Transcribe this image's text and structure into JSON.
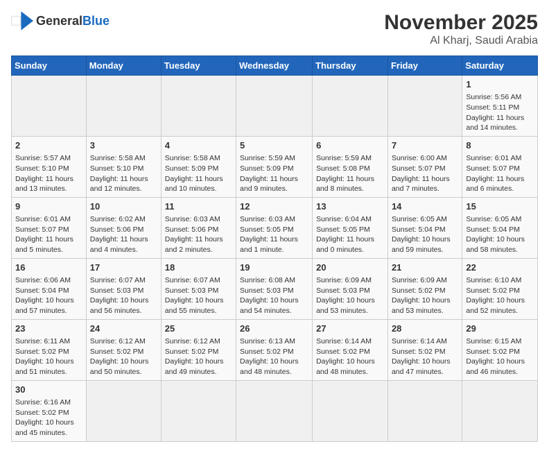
{
  "header": {
    "logo_general": "General",
    "logo_blue": "Blue",
    "month": "November 2025",
    "location": "Al Kharj, Saudi Arabia"
  },
  "weekdays": [
    "Sunday",
    "Monday",
    "Tuesday",
    "Wednesday",
    "Thursday",
    "Friday",
    "Saturday"
  ],
  "weeks": [
    [
      {
        "day": "",
        "info": ""
      },
      {
        "day": "",
        "info": ""
      },
      {
        "day": "",
        "info": ""
      },
      {
        "day": "",
        "info": ""
      },
      {
        "day": "",
        "info": ""
      },
      {
        "day": "",
        "info": ""
      },
      {
        "day": "1",
        "info": "Sunrise: 5:56 AM\nSunset: 5:11 PM\nDaylight: 11 hours and 14 minutes."
      }
    ],
    [
      {
        "day": "2",
        "info": "Sunrise: 5:57 AM\nSunset: 5:10 PM\nDaylight: 11 hours and 13 minutes."
      },
      {
        "day": "3",
        "info": "Sunrise: 5:58 AM\nSunset: 5:10 PM\nDaylight: 11 hours and 12 minutes."
      },
      {
        "day": "4",
        "info": "Sunrise: 5:58 AM\nSunset: 5:09 PM\nDaylight: 11 hours and 10 minutes."
      },
      {
        "day": "5",
        "info": "Sunrise: 5:59 AM\nSunset: 5:09 PM\nDaylight: 11 hours and 9 minutes."
      },
      {
        "day": "6",
        "info": "Sunrise: 5:59 AM\nSunset: 5:08 PM\nDaylight: 11 hours and 8 minutes."
      },
      {
        "day": "7",
        "info": "Sunrise: 6:00 AM\nSunset: 5:07 PM\nDaylight: 11 hours and 7 minutes."
      },
      {
        "day": "8",
        "info": "Sunrise: 6:01 AM\nSunset: 5:07 PM\nDaylight: 11 hours and 6 minutes."
      }
    ],
    [
      {
        "day": "9",
        "info": "Sunrise: 6:01 AM\nSunset: 5:07 PM\nDaylight: 11 hours and 5 minutes."
      },
      {
        "day": "10",
        "info": "Sunrise: 6:02 AM\nSunset: 5:06 PM\nDaylight: 11 hours and 4 minutes."
      },
      {
        "day": "11",
        "info": "Sunrise: 6:03 AM\nSunset: 5:06 PM\nDaylight: 11 hours and 2 minutes."
      },
      {
        "day": "12",
        "info": "Sunrise: 6:03 AM\nSunset: 5:05 PM\nDaylight: 11 hours and 1 minute."
      },
      {
        "day": "13",
        "info": "Sunrise: 6:04 AM\nSunset: 5:05 PM\nDaylight: 11 hours and 0 minutes."
      },
      {
        "day": "14",
        "info": "Sunrise: 6:05 AM\nSunset: 5:04 PM\nDaylight: 10 hours and 59 minutes."
      },
      {
        "day": "15",
        "info": "Sunrise: 6:05 AM\nSunset: 5:04 PM\nDaylight: 10 hours and 58 minutes."
      }
    ],
    [
      {
        "day": "16",
        "info": "Sunrise: 6:06 AM\nSunset: 5:04 PM\nDaylight: 10 hours and 57 minutes."
      },
      {
        "day": "17",
        "info": "Sunrise: 6:07 AM\nSunset: 5:03 PM\nDaylight: 10 hours and 56 minutes."
      },
      {
        "day": "18",
        "info": "Sunrise: 6:07 AM\nSunset: 5:03 PM\nDaylight: 10 hours and 55 minutes."
      },
      {
        "day": "19",
        "info": "Sunrise: 6:08 AM\nSunset: 5:03 PM\nDaylight: 10 hours and 54 minutes."
      },
      {
        "day": "20",
        "info": "Sunrise: 6:09 AM\nSunset: 5:03 PM\nDaylight: 10 hours and 53 minutes."
      },
      {
        "day": "21",
        "info": "Sunrise: 6:09 AM\nSunset: 5:02 PM\nDaylight: 10 hours and 53 minutes."
      },
      {
        "day": "22",
        "info": "Sunrise: 6:10 AM\nSunset: 5:02 PM\nDaylight: 10 hours and 52 minutes."
      }
    ],
    [
      {
        "day": "23",
        "info": "Sunrise: 6:11 AM\nSunset: 5:02 PM\nDaylight: 10 hours and 51 minutes."
      },
      {
        "day": "24",
        "info": "Sunrise: 6:12 AM\nSunset: 5:02 PM\nDaylight: 10 hours and 50 minutes."
      },
      {
        "day": "25",
        "info": "Sunrise: 6:12 AM\nSunset: 5:02 PM\nDaylight: 10 hours and 49 minutes."
      },
      {
        "day": "26",
        "info": "Sunrise: 6:13 AM\nSunset: 5:02 PM\nDaylight: 10 hours and 48 minutes."
      },
      {
        "day": "27",
        "info": "Sunrise: 6:14 AM\nSunset: 5:02 PM\nDaylight: 10 hours and 48 minutes."
      },
      {
        "day": "28",
        "info": "Sunrise: 6:14 AM\nSunset: 5:02 PM\nDaylight: 10 hours and 47 minutes."
      },
      {
        "day": "29",
        "info": "Sunrise: 6:15 AM\nSunset: 5:02 PM\nDaylight: 10 hours and 46 minutes."
      }
    ],
    [
      {
        "day": "30",
        "info": "Sunrise: 6:16 AM\nSunset: 5:02 PM\nDaylight: 10 hours and 45 minutes."
      },
      {
        "day": "",
        "info": ""
      },
      {
        "day": "",
        "info": ""
      },
      {
        "day": "",
        "info": ""
      },
      {
        "day": "",
        "info": ""
      },
      {
        "day": "",
        "info": ""
      },
      {
        "day": "",
        "info": ""
      }
    ]
  ]
}
